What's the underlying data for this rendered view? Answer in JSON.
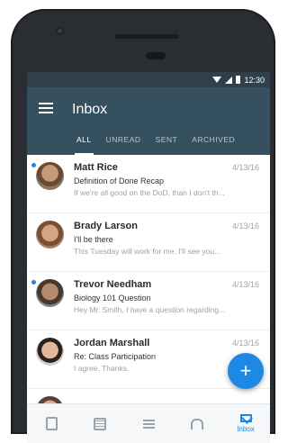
{
  "status_bar": {
    "time": "12:30"
  },
  "app_bar": {
    "title": "Inbox"
  },
  "tabs": [
    {
      "label": "ALL",
      "active": true
    },
    {
      "label": "UNREAD",
      "active": false
    },
    {
      "label": "SENT",
      "active": false
    },
    {
      "label": "ARCHIVED",
      "active": false
    }
  ],
  "messages": [
    {
      "name": "Matt Rice",
      "date": "4/13/16",
      "subject": "Definition of Done Recap",
      "preview": "If we're all good on the DoD, than I don't th...",
      "unread": true
    },
    {
      "name": "Brady Larson",
      "date": "4/13/16",
      "subject": "I'll be there",
      "preview": "This Tuesday will work for me. I'll see you...",
      "unread": false
    },
    {
      "name": "Trevor Needham",
      "date": "4/13/16",
      "subject": "Biology 101 Question",
      "preview": "Hey Mr. Smith, I have a question regarding...",
      "unread": true
    },
    {
      "name": "Jordan Marshall",
      "date": "4/13/16",
      "subject": "Re: Class Participation",
      "preview": "I agree. Thanks.",
      "unread": false
    },
    {
      "name": "",
      "date": "",
      "subject": "",
      "preview": "",
      "unread": false
    }
  ],
  "fab": {
    "icon": "plus-icon",
    "label": "+"
  },
  "bottom_nav": [
    {
      "icon": "book-icon",
      "label": "",
      "active": false
    },
    {
      "icon": "calendar-icon",
      "label": "",
      "active": false
    },
    {
      "icon": "list-icon",
      "label": "",
      "active": false
    },
    {
      "icon": "bell-icon",
      "label": "",
      "active": false
    },
    {
      "icon": "mail-icon",
      "label": "Inbox",
      "active": true
    }
  ],
  "colors": {
    "app_bar": "#35505f",
    "accent": "#1e88e5",
    "status_bar": "#2f3f4b"
  }
}
